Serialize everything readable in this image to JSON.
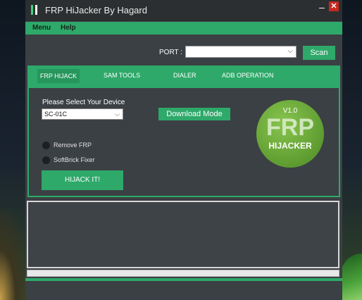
{
  "window": {
    "title": "FRP HiJacker By Hagard"
  },
  "menu": {
    "items": [
      "Menu",
      "Help"
    ]
  },
  "port": {
    "label": "PORT :",
    "value": ""
  },
  "scan_label": "Scan",
  "tabs": [
    "FRP HIJACK",
    "SAM TOOLS",
    "DIALER",
    "ADB OPERATION"
  ],
  "device": {
    "label": "Please Select Your Device",
    "value": "SC-01C"
  },
  "download_mode_label": "Download Mode",
  "options": [
    "Remove FRP",
    "SoftBrick Fixer"
  ],
  "hijack_label": "HIJACK IT!",
  "logo": {
    "version": "V1.0",
    "big": "FRP",
    "sub": "HIJACKER"
  },
  "progress": {
    "value": 0
  },
  "colors": {
    "accent": "#2ea96a",
    "window": "#3b4044",
    "titlebar": "#2c2f31",
    "close": "#c8281f"
  },
  "icons": {
    "app": "app-logo-icon",
    "minimize": "minimize-icon",
    "close": "close-icon",
    "dropdown": "chevron-down-icon"
  }
}
